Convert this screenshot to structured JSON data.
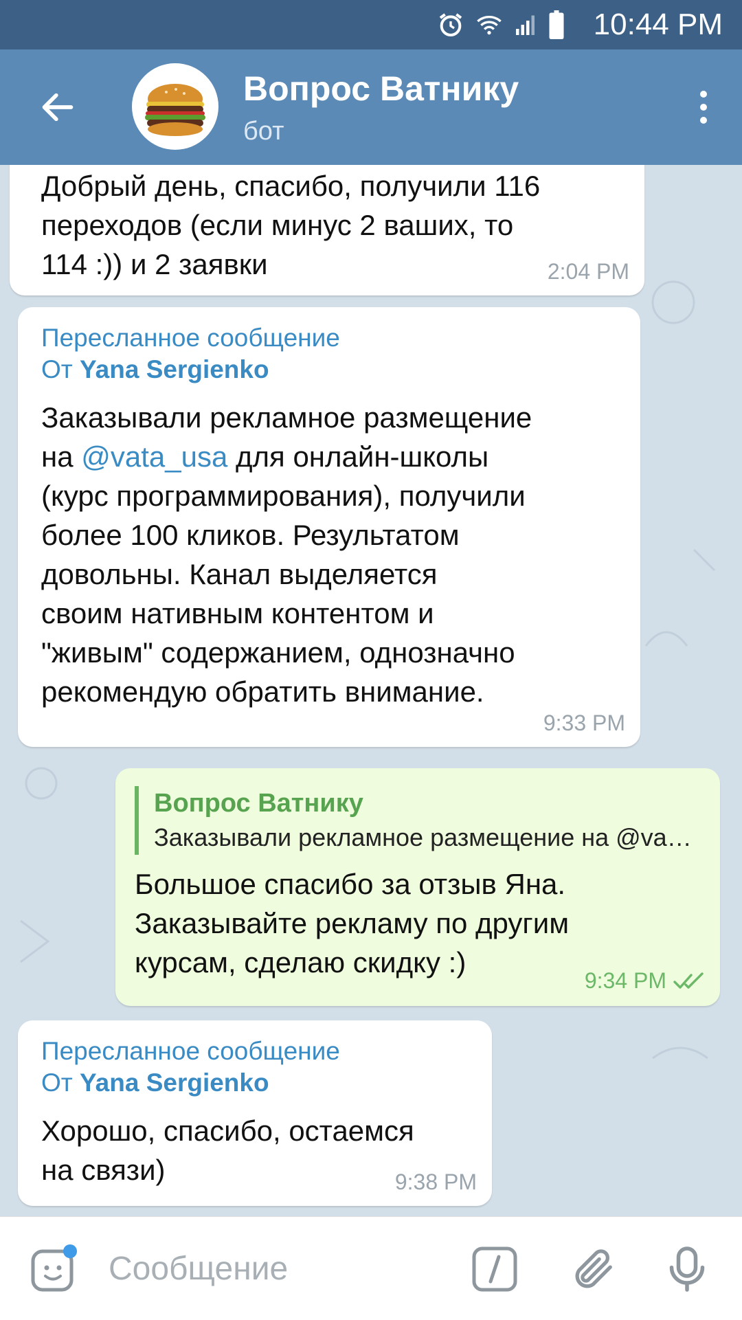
{
  "status_bar": {
    "time": "10:44 PM",
    "icons": [
      "alarm-icon",
      "wifi-icon",
      "signal-icon",
      "battery-icon"
    ]
  },
  "header": {
    "title": "Вопрос Ватнику",
    "subtitle": "бот",
    "avatar": "burger-avatar"
  },
  "messages": {
    "m1": {
      "text": "Добрый день, спасибо, получили 116\nпереходов (если минус 2 ваших, то\n114 :))  и 2 заявки",
      "time": "2:04 PM"
    },
    "m2": {
      "forward_label": "Пересланное сообщение",
      "from_prefix": "От ",
      "from_name": "Yana Sergienko",
      "text_before": "Заказывали рекламное размещение\nна ",
      "mention": "@vata_usa",
      "text_after": " для онлайн-школы\n(курс программирования), получили\nболее 100 кликов. Результатом\nдовольны.  Канал выделяется\nсвоим нативным контентом и\n\"живым\" содержанием, однозначно\nрекомендую обратить внимание.",
      "time": "9:33 PM"
    },
    "m3": {
      "reply_name": "Вопрос Ватнику",
      "reply_text": "Заказывали рекламное размещение на @vata_usa для онлайн-школы",
      "text": "Большое спасибо за отзыв Яна.\nЗаказывайте рекламу по другим\nкурсам, сделаю скидку :)",
      "time": "9:34 PM",
      "status": "read-double-check"
    },
    "m4": {
      "forward_label": "Пересланное сообщение",
      "from_prefix": "От ",
      "from_name": "Yana Sergienko",
      "text": "Хорошо, спасибо, остаемся\nна связи)",
      "time": "9:38 PM"
    }
  },
  "input": {
    "placeholder": "Сообщение"
  },
  "colors": {
    "status_bar": "#3d6186",
    "app_bar": "#5a8ab5",
    "link": "#3a8bc4",
    "outgoing_bubble": "#effdde",
    "outgoing_accent": "#58a34f"
  }
}
